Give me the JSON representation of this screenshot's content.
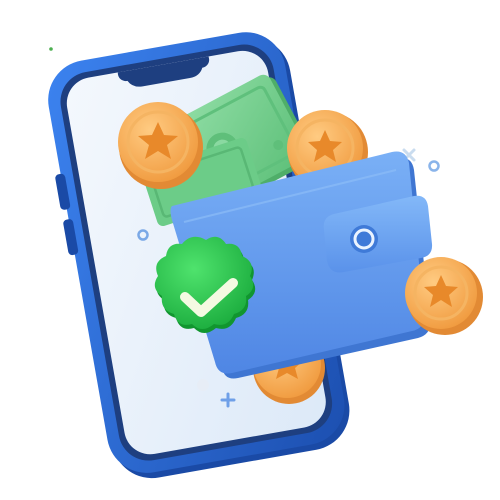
{
  "illustration": {
    "subject": "phone-wallet-payment-success",
    "icons": [
      "phone-icon",
      "wallet-icon",
      "banknote-icon",
      "coin-star-icon",
      "verified-badge-check-icon",
      "sparkle-icon"
    ],
    "colors": {
      "phone_frame": "#2d6fe0",
      "phone_frame_dark": "#1c4fb0",
      "phone_screen": "#e9f2fb",
      "wallet": "#5c9af0",
      "wallet_dark": "#3f7ad8",
      "banknote": "#7fd497",
      "banknote_dark": "#4fb26c",
      "coin": "#f7a851",
      "coin_star": "#e58a2b",
      "badge": "#22c44a",
      "check": "#f4fae2",
      "accent": "#7aa8e6"
    }
  }
}
